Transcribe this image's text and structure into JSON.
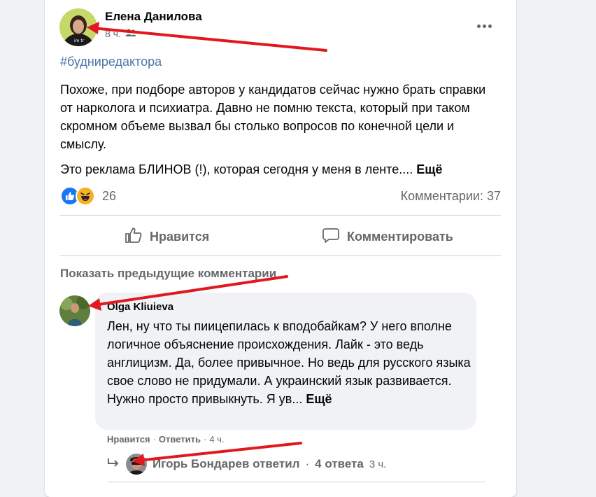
{
  "post": {
    "author": "Елена Данилова",
    "time": "8 ч.",
    "audience_icon": "friends-icon",
    "hashtag": "#будниредактора",
    "text_p1": "Похоже, при подборе авторов у кандидатов сейчас нужно брать справки от нарколога и психиатра. Давно не помню текста, который при таком скромном объеме вызвал бы столько вопросов по конечной цели и смыслу.",
    "text_p2": "Это реклама БЛИНОВ (!), которая сегодня у меня в ленте....",
    "see_more": "Ещё",
    "reaction_count": "26",
    "comments_count": "Комментарии: 37"
  },
  "actions": {
    "like": "Нравится",
    "comment": "Комментировать"
  },
  "comments": {
    "show_previous": "Показать предыдущие комментарии",
    "items": [
      {
        "author": "Olga Kliuieva",
        "text": "Лен, ну что ты пиицепилась к вподобайкам? У него вполне логичное объяснение происхождения. Лайк - это ведь англицизм. Да, более привычное. Но ведь для русского языка свое слово не придумали. А украинский язык развивается. Нужно просто привыкнуть. Я ув...",
        "see_more": "Ещё",
        "like": "Нравится",
        "separator": "·",
        "reply": "Ответить",
        "time": "4 ч."
      }
    ],
    "replies": {
      "author": "Игорь Бондарев ответил",
      "separator": "·",
      "count": "4 ответа",
      "time": "3 ч."
    }
  },
  "colors": {
    "page_bg": "#f0f2f5",
    "card_bg": "#ffffff",
    "hashtag": "#4a76a8",
    "secondary_text": "#65676b",
    "annotation_arrow": "#e0191f",
    "like_blue": "#1877f2",
    "haha_yellow": "#f7b125"
  }
}
